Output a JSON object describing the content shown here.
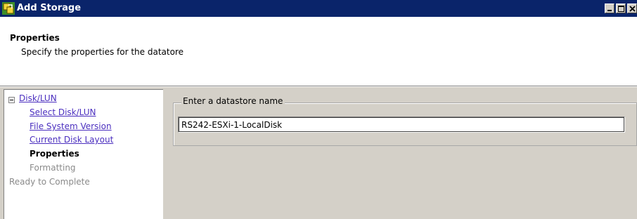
{
  "window": {
    "title": "Add Storage",
    "controls": {
      "minimize": "minimize",
      "maximize": "maximize",
      "close": "close"
    }
  },
  "header": {
    "title": "Properties",
    "subtitle": "Specify the properties for the datatore"
  },
  "sidebar": {
    "root": {
      "label": "Disk/LUN",
      "expanded": true
    },
    "items": [
      {
        "label": "Select Disk/LUN",
        "state": "link"
      },
      {
        "label": "File System Version",
        "state": "link"
      },
      {
        "label": "Current Disk Layout",
        "state": "link"
      },
      {
        "label": "Properties",
        "state": "current"
      },
      {
        "label": "Formatting",
        "state": "disabled"
      }
    ],
    "final": {
      "label": "Ready to Complete",
      "state": "disabled"
    }
  },
  "form": {
    "group_label": "Enter a datastore name",
    "datastore_name": "RS242-ESXi-1-LocalDisk"
  },
  "colors": {
    "titlebar": "#0a246a",
    "link": "#4b2fbf",
    "disabled": "#8a8a8a",
    "dialog": "#d4d0c8"
  }
}
